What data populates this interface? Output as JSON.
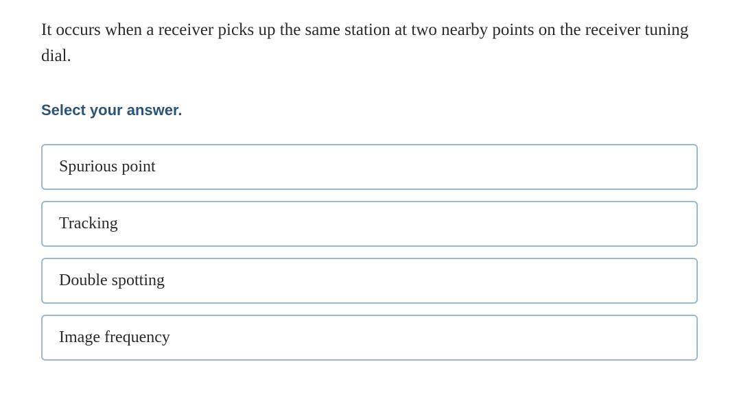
{
  "question": {
    "text": "It occurs when a receiver picks up the same station at two nearby points on the receiver tuning dial."
  },
  "prompt": "Select your answer.",
  "options": [
    {
      "label": "Spurious point"
    },
    {
      "label": "Tracking"
    },
    {
      "label": "Double spotting"
    },
    {
      "label": "Image frequency"
    }
  ]
}
